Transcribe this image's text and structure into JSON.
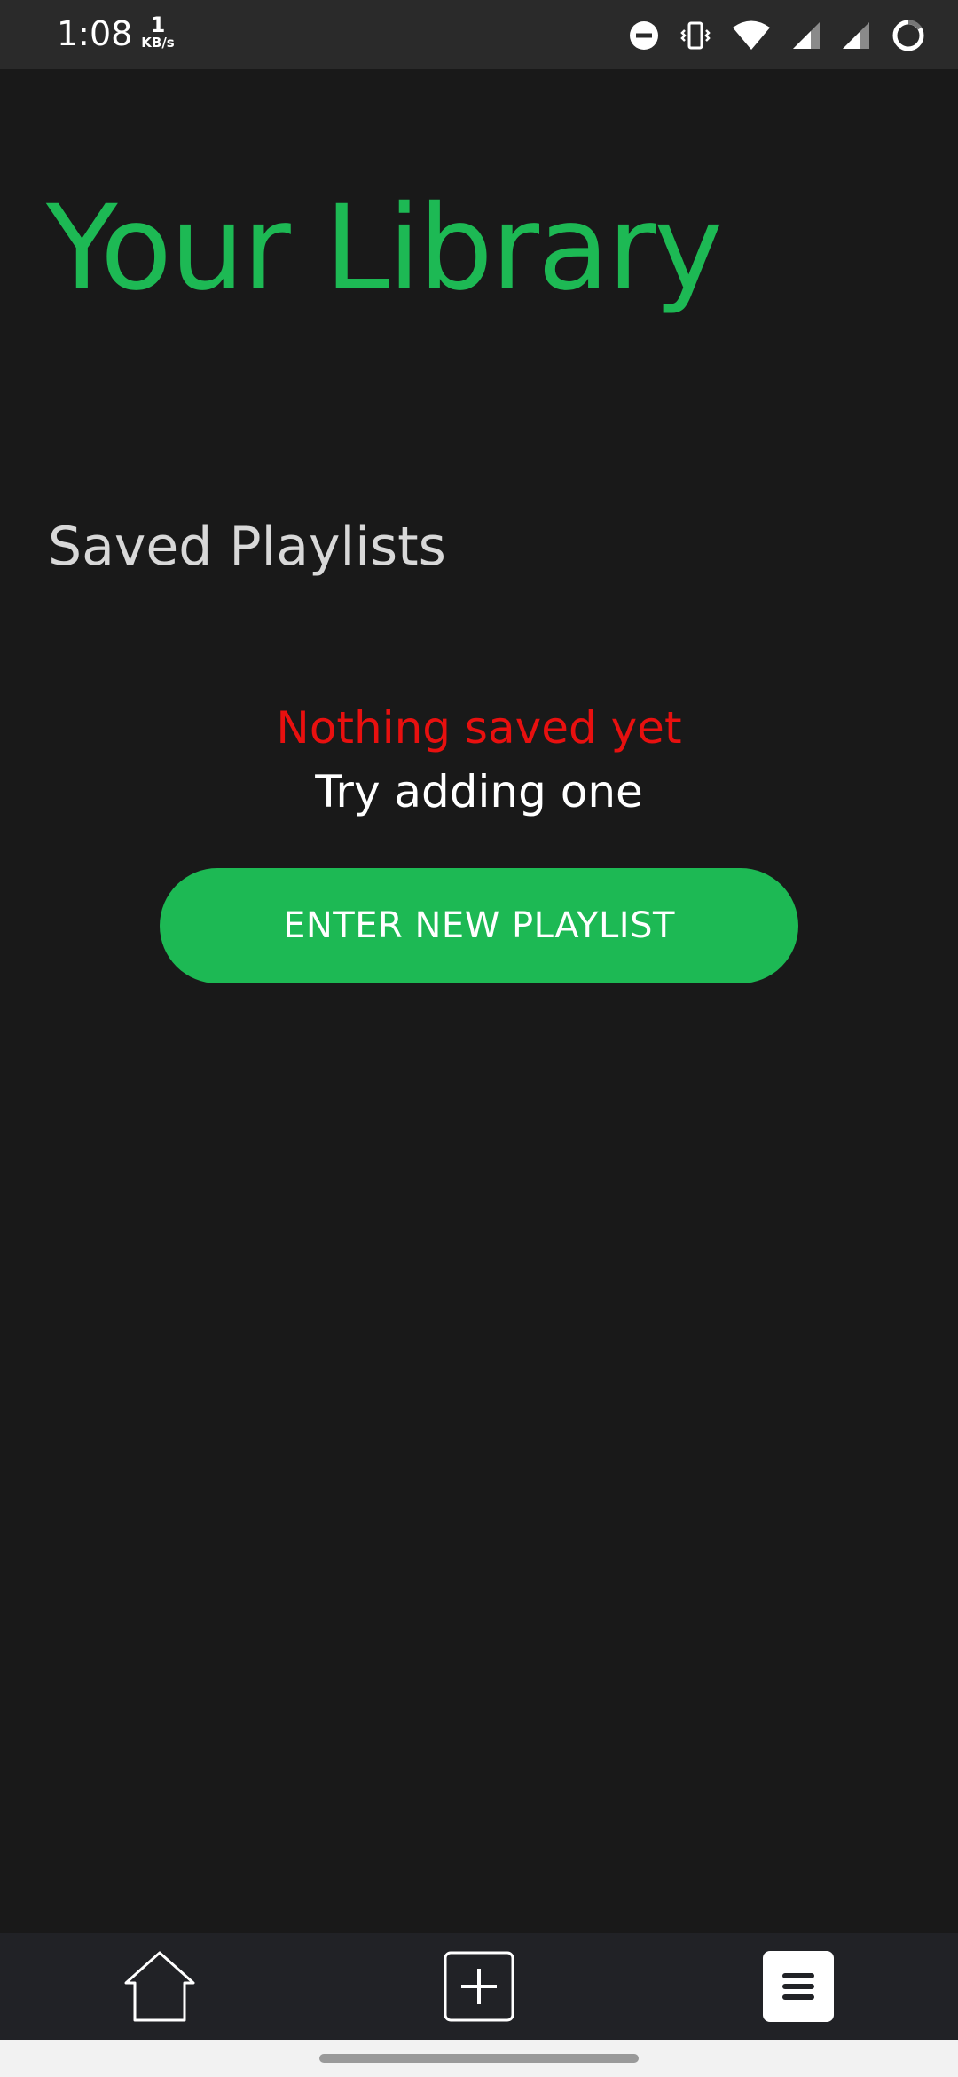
{
  "status_bar": {
    "time": "1:08",
    "net_speed_value": "1",
    "net_speed_unit": "KB/s",
    "icons": [
      "do-not-disturb-icon",
      "vibrate-icon",
      "wifi-icon",
      "signal-icon",
      "signal-icon",
      "battery-icon"
    ]
  },
  "library": {
    "title": "Your Library",
    "section_title": "Saved Playlists",
    "empty_title": "Nothing saved yet",
    "empty_subtitle": "Try adding one",
    "button_label": "ENTER NEW PLAYLIST"
  },
  "nav": {
    "items": [
      "home-icon",
      "add-icon",
      "menu-icon"
    ]
  },
  "colors": {
    "accent": "#1db954",
    "background": "#191919",
    "error": "#e8100f",
    "nav_background": "#212226"
  }
}
